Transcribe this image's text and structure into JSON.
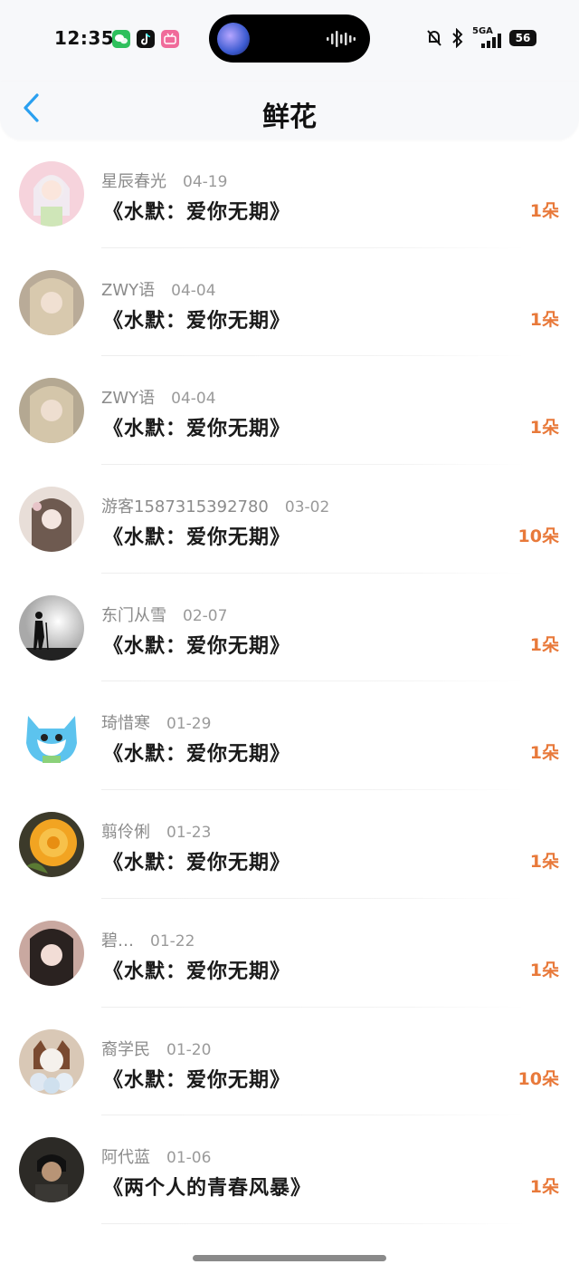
{
  "status_bar": {
    "time": "12:35",
    "apps": [
      {
        "icon": "wechat-icon",
        "color": "#2ec05c"
      },
      {
        "icon": "tiktok-icon",
        "color": "#111111"
      },
      {
        "icon": "bilibili-icon",
        "color": "#f06b9a"
      }
    ],
    "network": "5GA",
    "battery": "56"
  },
  "header": {
    "title": "鲜花",
    "back_icon": "chevron-left-icon",
    "accent": "#2aa0f0"
  },
  "records": [
    {
      "user": "星辰春光",
      "date": "04-19",
      "book": "《水默：爱你无期》",
      "count": "1朵"
    },
    {
      "user": "ZWY语",
      "date": "04-04",
      "book": "《水默：爱你无期》",
      "count": "1朵"
    },
    {
      "user": "ZWY语",
      "date": "04-04",
      "book": "《水默：爱你无期》",
      "count": "1朵"
    },
    {
      "user": "游客1587315392780",
      "date": "03-02",
      "book": "《水默：爱你无期》",
      "count": "10朵"
    },
    {
      "user": "东门从雪",
      "date": "02-07",
      "book": "《水默：爱你无期》",
      "count": "1朵"
    },
    {
      "user": "琦惜寒",
      "date": "01-29",
      "book": "《水默：爱你无期》",
      "count": "1朵"
    },
    {
      "user": "翦伶俐",
      "date": "01-23",
      "book": "《水默：爱你无期》",
      "count": "1朵"
    },
    {
      "user": "碧…",
      "date": "01-22",
      "book": "《水默：爱你无期》",
      "count": "1朵"
    },
    {
      "user": "裔学民",
      "date": "01-20",
      "book": "《水默：爱你无期》",
      "count": "10朵"
    },
    {
      "user": "阿代蓝",
      "date": "01-06",
      "book": "《两个人的青春风暴》",
      "count": "1朵"
    }
  ],
  "count_color": "#e8793a"
}
